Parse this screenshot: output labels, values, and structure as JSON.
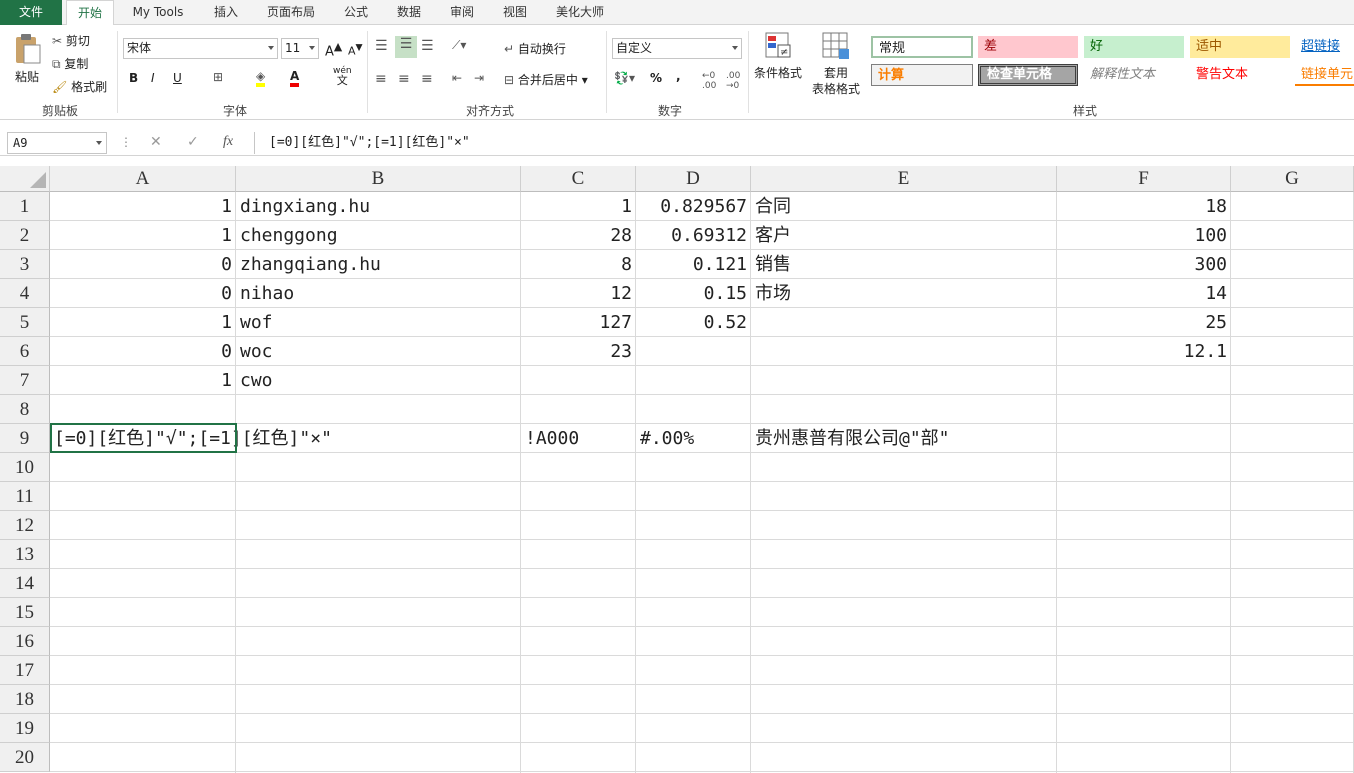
{
  "tabs": [
    "文件",
    "开始",
    "My Tools",
    "插入",
    "页面布局",
    "公式",
    "数据",
    "审阅",
    "视图",
    "美化大师"
  ],
  "ribbon": {
    "clipboard": {
      "paste": "粘贴",
      "cut": "剪切",
      "copy": "复制",
      "format_painter": "格式刷",
      "label": "剪贴板"
    },
    "font": {
      "name": "宋体",
      "size": "11",
      "bold": "B",
      "italic": "I",
      "underline": "U",
      "label": "字体",
      "wen": "wén"
    },
    "align": {
      "wrap": "自动换行",
      "merge": "合并后居中",
      "label": "对齐方式"
    },
    "number": {
      "format": "自定义",
      "percent": "%",
      "comma": ",",
      "label": "数字"
    },
    "styles": {
      "cond_format": "条件格式",
      "table_format_1": "套用",
      "table_format_2": "表格格式",
      "label": "样式",
      "items": [
        {
          "text": "常规",
          "color": "#000000",
          "bg": "#ffffff"
        },
        {
          "text": "差",
          "color": "#9c0006",
          "bg": "#ffc7ce"
        },
        {
          "text": "好",
          "color": "#006100",
          "bg": "#c6efce"
        },
        {
          "text": "适中",
          "color": "#9c5700",
          "bg": "#ffeb9c"
        },
        {
          "text": "超链接",
          "color": "#0563c1",
          "bg": "#ffffff"
        },
        {
          "text": "计算",
          "color": "#fa7d00",
          "bg": "#f2f2f2"
        },
        {
          "text": "检查单元格",
          "color": "#ffffff",
          "bg": "#a5a5a5"
        },
        {
          "text": "解释性文本",
          "color": "#7f7f7f",
          "bg": "#ffffff"
        },
        {
          "text": "警告文本",
          "color": "#ff0000",
          "bg": "#ffffff"
        },
        {
          "text": "链接单元",
          "color": "#fa7d00",
          "bg": "#ffffff"
        }
      ]
    }
  },
  "formula_bar": {
    "cell_ref": "A9",
    "cancel": "✕",
    "enter": "✓",
    "fx": "fx",
    "content": "[=0][红色]\"√\";[=1][红色]\"×\""
  },
  "columns": [
    "A",
    "B",
    "C",
    "D",
    "E",
    "F",
    "G"
  ],
  "rows": [
    "1",
    "2",
    "3",
    "4",
    "5",
    "6",
    "7",
    "8",
    "9",
    "10",
    "11",
    "12",
    "13",
    "14",
    "15",
    "16",
    "17",
    "18",
    "19",
    "20"
  ],
  "cells": {
    "A": [
      "1",
      "1",
      "0",
      "0",
      "1",
      "0",
      "1",
      "",
      "[=0][红色]\"√\";[=1][红色]\"×\""
    ],
    "B": [
      "dingxiang.hu",
      "chenggong",
      "zhangqiang.hu",
      "nihao",
      "wof",
      "woc",
      "cwo",
      "",
      ""
    ],
    "C": [
      "1",
      "28",
      "8",
      "12",
      "127",
      "23",
      "",
      "",
      "!A000"
    ],
    "D": [
      "0.829567",
      "0.69312",
      "0.121",
      "0.15",
      "0.52",
      "",
      "",
      "",
      "#.00%"
    ],
    "E": [
      "合同",
      "客户",
      "销售",
      "市场",
      "",
      "",
      "",
      "",
      "贵州惠普有限公司@\"部\""
    ],
    "F": [
      "18",
      "100",
      "300",
      "14",
      "25",
      "12.1",
      "",
      "",
      ""
    ]
  }
}
